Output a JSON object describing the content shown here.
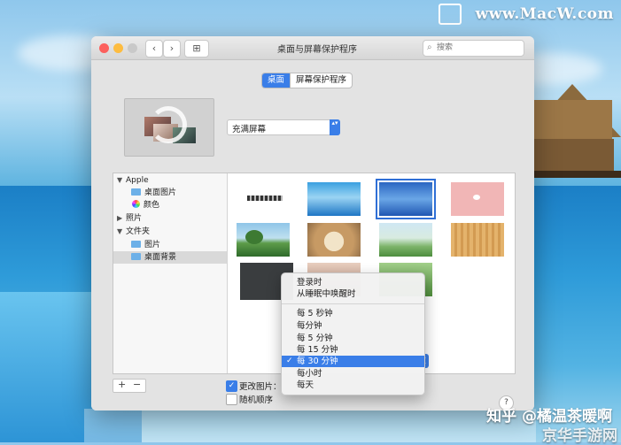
{
  "watermark": {
    "site": "www.MacW.com"
  },
  "credit": {
    "line1": "知乎 @橘温茶暖啊",
    "line2": "京华手游网"
  },
  "window": {
    "title": "桌面与屏幕保护程序",
    "search_placeholder": "搜索",
    "nav_back": "‹",
    "nav_forward": "›",
    "grid_icon": "⊞"
  },
  "tabs": [
    {
      "label": "桌面",
      "active": true
    },
    {
      "label": "屏幕保护程序",
      "active": false
    }
  ],
  "fit_popup": {
    "value": "充满屏幕",
    "arrow": "▴▾"
  },
  "sidebar": {
    "items": [
      {
        "label": "Apple",
        "type": "group",
        "disclosure": "▼"
      },
      {
        "label": "桌面图片",
        "type": "folder"
      },
      {
        "label": "颜色",
        "type": "colors"
      },
      {
        "label": "照片",
        "type": "group",
        "disclosure": "▶"
      },
      {
        "label": "文件夹",
        "type": "group",
        "disclosure": "▼"
      },
      {
        "label": "图片",
        "type": "folder"
      },
      {
        "label": "桌面背景",
        "type": "folder",
        "selected": true
      }
    ]
  },
  "thumbnails": [
    {
      "name": "thumb-blurred-text",
      "style": "blurred"
    },
    {
      "name": "thumb-island-pool",
      "style": "pool"
    },
    {
      "name": "thumb-blue-sea",
      "style": "sea",
      "selected": true
    },
    {
      "name": "thumb-pink-bird",
      "style": "pink"
    },
    {
      "name": "thumb-tree-field",
      "style": "tree"
    },
    {
      "name": "thumb-cat",
      "style": "cat"
    },
    {
      "name": "thumb-girl-meadow",
      "style": "meadow"
    },
    {
      "name": "thumb-wood",
      "style": "wood"
    },
    {
      "name": "thumb-dark-fabric",
      "style": "dark"
    },
    {
      "name": "thumb-portrait",
      "style": "portrait"
    },
    {
      "name": "thumb-green",
      "style": "green"
    }
  ],
  "controls": {
    "add": "+",
    "remove": "−",
    "change_picture_label": "更改图片：",
    "change_picture_checked": true,
    "random_order_label": "随机顺序",
    "random_order_checked": false,
    "help": "?"
  },
  "interval_menu": {
    "checkmark": "✓",
    "items": [
      {
        "label": "登录时"
      },
      {
        "label": "从睡眠中唤醒时"
      },
      {
        "label": "每 5 秒钟"
      },
      {
        "label": "每分钟"
      },
      {
        "label": "每 5 分钟"
      },
      {
        "label": "每 15 分钟"
      },
      {
        "label": "每 30 分钟",
        "selected": true
      },
      {
        "label": "每小时"
      },
      {
        "label": "每天"
      }
    ]
  },
  "colors": {
    "accent": "#3a7ee8",
    "close": "#fc605c",
    "minimize": "#fdbc40",
    "zoom": "#c9c9c9"
  }
}
